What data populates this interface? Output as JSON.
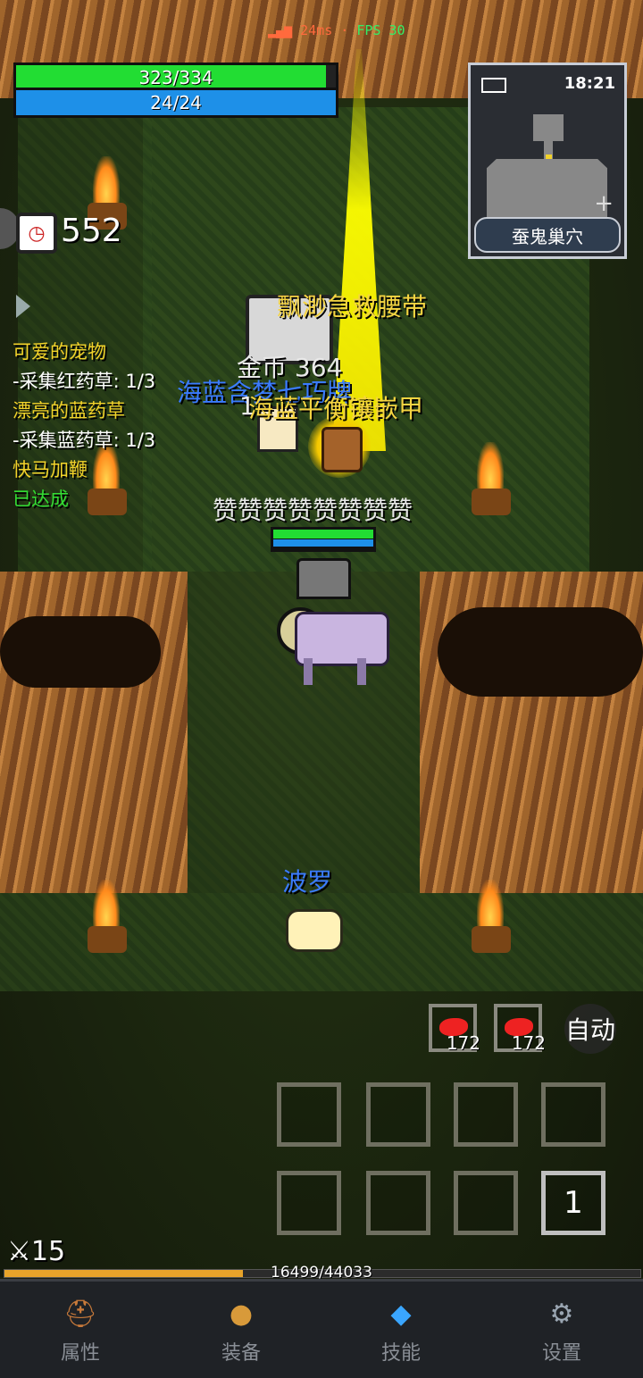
{
  "hud": {
    "ping": "24ms",
    "fps": "FPS 30",
    "hp": "323/334",
    "hp_fraction": 0.97,
    "mp": "24/24",
    "mp_fraction": 1.0,
    "timer": "552"
  },
  "minimap": {
    "time": "18:21",
    "location": "蚕鬼巢穴"
  },
  "quests": [
    {
      "title": "可爱的宠物",
      "detail": "-采集红药草: 1/3"
    },
    {
      "title": "漂亮的蓝药草",
      "detail": "-采集蓝药草: 1/3"
    },
    {
      "title": "快马加鞭",
      "detail": "已达成"
    }
  ],
  "floating_texts": {
    "item1": "飘渺急救腰带",
    "gold": "金币 364",
    "item2": "海蓝含梦七巧牌",
    "item3": "海蓝平衡镶嵌甲",
    "number": "1",
    "player_name": "赞赞赞赞赞赞赞赞",
    "pet_name": "波罗"
  },
  "quick_items": [
    {
      "count": "172"
    },
    {
      "count": "172"
    }
  ],
  "auto_button": "自动",
  "skill_slot_count": "1",
  "level": "15",
  "exp": {
    "text": "16499/44033",
    "fraction": 0.375
  },
  "nav": [
    {
      "label": "属性",
      "icon": "helmet-icon"
    },
    {
      "label": "装备",
      "icon": "bag-icon"
    },
    {
      "label": "技能",
      "icon": "gem-icon"
    },
    {
      "label": "设置",
      "icon": "gear-icon"
    }
  ],
  "colors": {
    "hp": "#22dd33",
    "mp": "#1e90e8",
    "exp": "#e8a42a",
    "quest_title": "#f2d22a",
    "quest_done": "#33dd33",
    "item_yellow": "#f5d442",
    "item_blue": "#3a7bff"
  }
}
